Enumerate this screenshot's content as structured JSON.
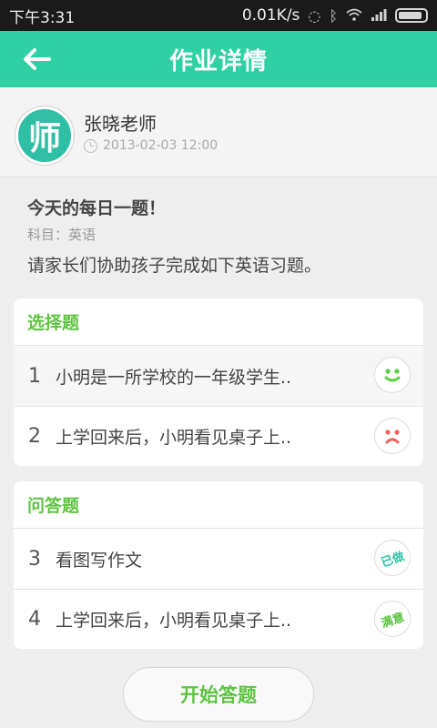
{
  "status_bar": {
    "time": "下午3:31",
    "network_speed": "0.01K/s"
  },
  "header": {
    "title": "作业详情",
    "back_icon": "arrow-left-icon"
  },
  "teacher": {
    "avatar_char": "师",
    "name": "张晓老师",
    "time": "2013-02-03 12:00"
  },
  "homework": {
    "title": "今天的每日一题！",
    "subject": "科目：英语",
    "description": "请家长们协助孩子完成如下英语习题。"
  },
  "sections": [
    {
      "title": "选择题",
      "questions": [
        {
          "num": "1",
          "text": "小明是一所学校的一年级学生..",
          "status": "smile-face-icon"
        },
        {
          "num": "2",
          "text": "上学回来后，小明看见桌子上..",
          "status": "sad-face-icon"
        }
      ]
    },
    {
      "title": "问答题",
      "questions": [
        {
          "num": "3",
          "text": "看图写作文",
          "status_label": "已做"
        },
        {
          "num": "4",
          "text": "上学回来后，小明看见桌子上..",
          "status_label": "满意"
        }
      ]
    }
  ],
  "footer": {
    "start_button": "开始答题"
  },
  "colors": {
    "accent": "#2fd0a4",
    "section_green": "#5ec341",
    "smile_green": "#5bd042",
    "sad_red": "#f0625b",
    "done_teal": "#2fc3a6"
  }
}
